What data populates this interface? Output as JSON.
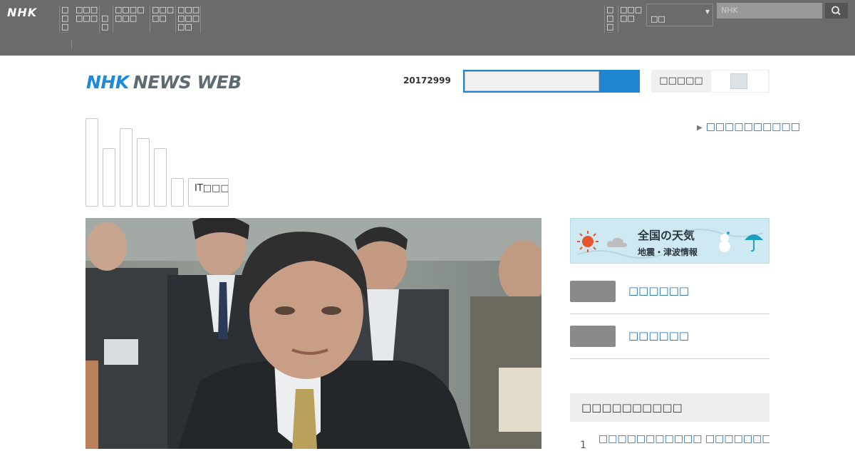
{
  "topbar": {
    "logo": "NHK",
    "nav": [
      "□□□□",
      "□□□□□□",
      "□□",
      "□□□□□□□",
      "□□□□□",
      "□□□□□□□□"
    ],
    "right_nav": [
      "□□□□",
      "□□□□□"
    ],
    "region_select_value": "□□",
    "search_placeholder": "NHK"
  },
  "header": {
    "logo_nhk": "NHK",
    "logo_news_web": "NEWS WEB",
    "date": "20172999",
    "toggle_label": "□□□□□"
  },
  "category_tabs": [
    "",
    "",
    "",
    "",
    "",
    "",
    "IT□□□"
  ],
  "side_link": "□□□□□□□□□□",
  "weather": {
    "title": "全国の天気",
    "subtitle": "地震・津波情報"
  },
  "right_links": [
    "□□□□□□",
    "□□□□□□"
  ],
  "ranking": {
    "heading": "□□□□□□□□□□",
    "items": [
      {
        "rank": "1",
        "text": "□□□□□□□□□□□ □□□□□□□□□□□□□□□□"
      }
    ]
  }
}
